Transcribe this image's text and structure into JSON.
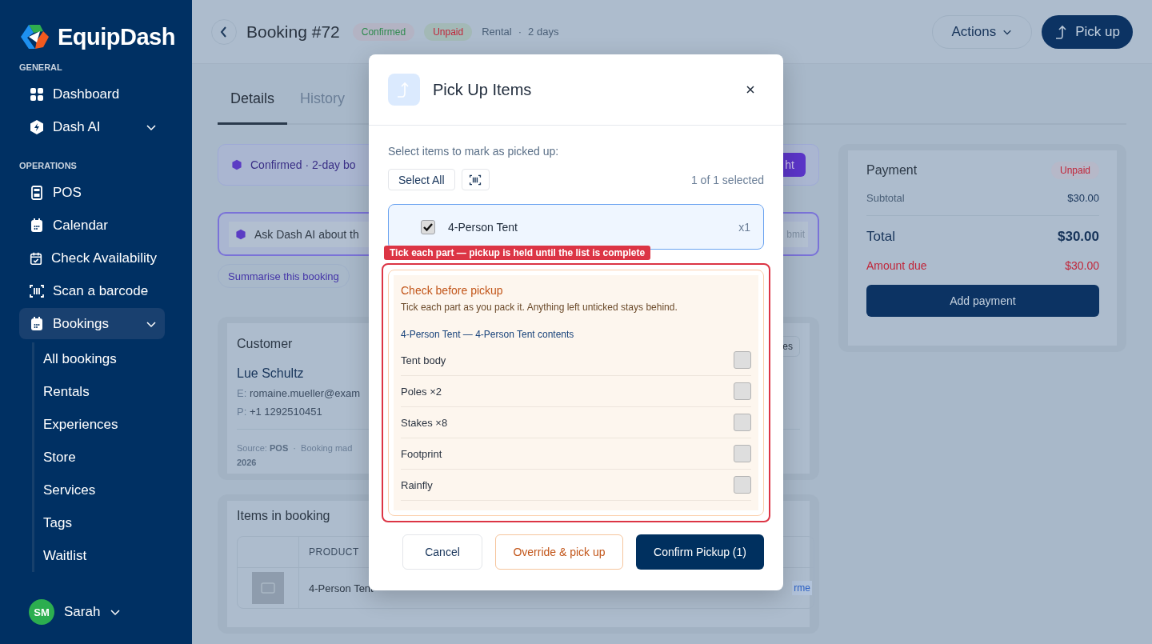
{
  "sidebar": {
    "brand": "EquipDash",
    "sections": [
      {
        "heading": "GENERAL",
        "items": [
          {
            "label": "Dashboard",
            "selected": false
          },
          {
            "label": "Dash AI",
            "selected": false,
            "has_menu": true
          }
        ]
      },
      {
        "heading": "OPERATIONS",
        "items": [
          {
            "label": "POS",
            "selected": false
          },
          {
            "label": "Calendar",
            "selected": false
          },
          {
            "label": "Check Availability",
            "selected": false
          },
          {
            "label": "Scan a barcode",
            "selected": false
          },
          {
            "label": "Bookings",
            "selected": true,
            "has_menu": true,
            "children": [
              {
                "label": "All bookings",
                "selected": false
              },
              {
                "label": "Rentals",
                "selected": false
              },
              {
                "label": "Experiences",
                "selected": false
              },
              {
                "label": "Store",
                "selected": false
              },
              {
                "label": "Services",
                "selected": false
              },
              {
                "label": "Tags",
                "selected": false
              },
              {
                "label": "Waitlist",
                "selected": false
              }
            ]
          }
        ]
      }
    ],
    "user": {
      "initials": "SM",
      "name": "Sarah"
    }
  },
  "header": {
    "title": "Booking #72",
    "badges": [
      {
        "label": "Confirmed",
        "color": "#2e8a4e"
      },
      {
        "label": "Unpaid",
        "color": "#c0263a"
      }
    ],
    "type": "Rental",
    "separator": "·",
    "duration": "2 days",
    "actions": "Actions",
    "pickup": "Pick up"
  },
  "tabs": [
    {
      "label": "Details",
      "selected": true
    },
    {
      "label": "History",
      "selected": false
    }
  ],
  "summary": {
    "text": "Confirmed · 2-day bo",
    "button": "ht"
  },
  "ask": {
    "placeholder": "Ask Dash AI about th",
    "submit": "bmit"
  },
  "chips": [
    "Summarise this booking"
  ],
  "customer": {
    "heading": "Customer",
    "name": "Lue Schultz",
    "email_label": "E:",
    "email": "romaine.mueller@exam",
    "phone_label": "P:",
    "phone": "+1 1292510451",
    "source_label": "Source:",
    "source": "POS",
    "separator": "·",
    "made": "Booking mad",
    "year": "2026",
    "button": "es"
  },
  "items_card": {
    "heading": "Items in booking",
    "columns": [
      "PRODUCT"
    ],
    "rows": [
      {
        "product": "4-Person Tent",
        "link": "rme"
      }
    ]
  },
  "payment": {
    "heading": "Payment",
    "status": "Unpaid",
    "subtotal_label": "Subtotal",
    "subtotal": "$30.00",
    "total_label": "Total",
    "total": "$30.00",
    "due_label": "Amount due",
    "due": "$30.00",
    "button": "Add payment"
  },
  "modal": {
    "title": "Pick Up Items",
    "prompt": "Select items to mark as picked up:",
    "select_all": "Select All",
    "count": "1 of 1 selected",
    "items": [
      {
        "name": "4-Person Tent",
        "qty": "x1",
        "checked": true
      }
    ],
    "warning": "Tick each part — pickup is held until the list is complete",
    "checklist": {
      "title": "Check before pickup",
      "note": "Tick each part as you pack it. Anything left unticked stays behind.",
      "group": "4-Person Tent — 4-Person Tent contents",
      "parts": [
        {
          "name": "Tent body",
          "checked": false
        },
        {
          "name": "Poles ×2",
          "checked": false
        },
        {
          "name": "Stakes ×8",
          "checked": false
        },
        {
          "name": "Footprint",
          "checked": false
        },
        {
          "name": "Rainfly",
          "checked": false
        }
      ]
    },
    "cancel": "Cancel",
    "override": "Override & pick up",
    "confirm": "Confirm Pickup (1)"
  }
}
